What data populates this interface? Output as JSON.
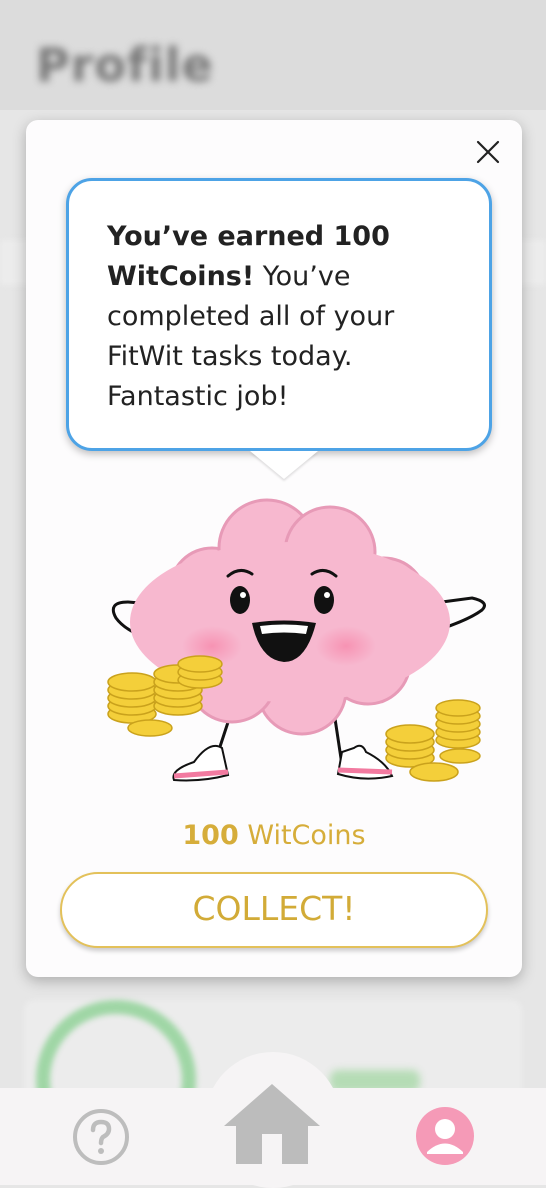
{
  "background": {
    "page_title": "Profile"
  },
  "modal": {
    "message_bold": "You’ve earned 100 WitCoins!",
    "message_rest": " You’ve completed all of your FitWit tasks today. Fantastic job!",
    "coins_amount": "100",
    "coins_unit": " WitCoins",
    "collect_label": "COLLECT!",
    "close_icon": "close-icon",
    "mascot": "brain-mascot-illustration"
  },
  "bottom_nav": {
    "items": [
      {
        "icon": "help-icon"
      },
      {
        "icon": "home-icon"
      },
      {
        "icon": "profile-icon"
      }
    ]
  },
  "colors": {
    "bubble_border": "#4da3e6",
    "coin_gold": "#d6ad3a",
    "collect_border": "#e3c15a",
    "brain_pink": "#f7b8cf",
    "profile_active": "#f59ab7",
    "nav_inactive": "#bdbdbd"
  }
}
